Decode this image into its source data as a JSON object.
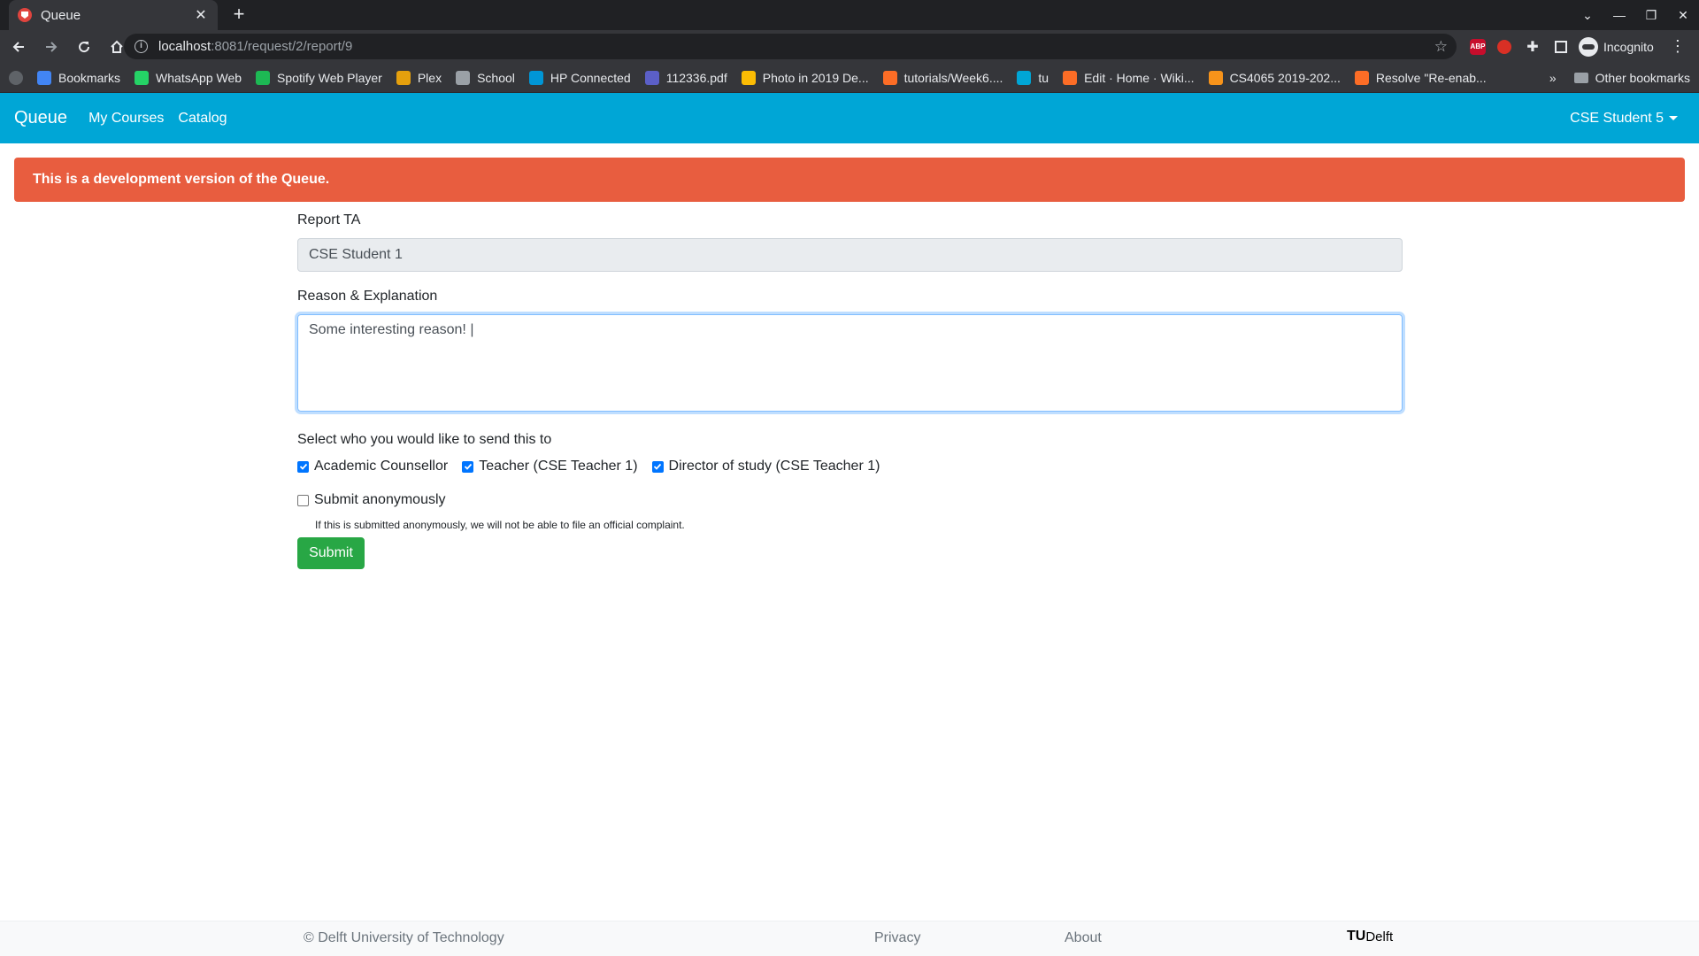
{
  "browser": {
    "tab_title": "Queue",
    "url_host": "localhost",
    "url_rest": ":8081/request/2/report/9",
    "incognito_label": "Incognito",
    "bookmarks": [
      {
        "label": "Bookmarks",
        "color": "#4285f4"
      },
      {
        "label": "WhatsApp Web",
        "color": "#25d366"
      },
      {
        "label": "Spotify Web Player",
        "color": "#1db954"
      },
      {
        "label": "Plex",
        "color": "#e5a00d"
      },
      {
        "label": "School",
        "color": "#9aa0a6"
      },
      {
        "label": "HP Connected",
        "color": "#0096d6"
      },
      {
        "label": "112336.pdf",
        "color": "#5b5fc7"
      },
      {
        "label": "Photo in 2019 De...",
        "color": "#fbbc04"
      },
      {
        "label": "tutorials/Week6....",
        "color": "#fc6d26"
      },
      {
        "label": "tu",
        "color": "#00a6d6"
      },
      {
        "label": "Edit · Home · Wiki...",
        "color": "#fc6d26"
      },
      {
        "label": "CS4065 2019-202...",
        "color": "#f7931a"
      },
      {
        "label": "Resolve \"Re-enab...",
        "color": "#fc6d26"
      }
    ],
    "overflow_label": "»",
    "other_bookmarks": "Other bookmarks"
  },
  "nav": {
    "brand": "Queue",
    "links": [
      "My Courses",
      "Catalog"
    ],
    "user": "CSE Student 5"
  },
  "alert": "This is a development version of the Queue.",
  "form": {
    "report_label": "Report TA",
    "report_value": "CSE Student 1",
    "reason_label": "Reason & Explanation",
    "reason_value": "Some interesting reason! |",
    "send_label": "Select who you would like to send this to",
    "recipients": [
      {
        "label": "Academic Counsellor",
        "checked": true
      },
      {
        "label": "Teacher (CSE Teacher 1)",
        "checked": true
      },
      {
        "label": "Director of study (CSE Teacher 1)",
        "checked": true
      }
    ],
    "anon_label": "Submit anonymously",
    "anon_checked": false,
    "anon_note": "If this is submitted anonymously, we will not be able to file an official complaint.",
    "submit_label": "Submit"
  },
  "footer": {
    "copyright": "© Delft University of Technology",
    "privacy": "Privacy",
    "about": "About",
    "logo_tu": "TU",
    "logo_delft": "Delft"
  },
  "colors": {
    "navbar": "#00a6d6",
    "alert": "#e85d3f",
    "submit": "#28a745",
    "checkbox": "#0075ff"
  }
}
